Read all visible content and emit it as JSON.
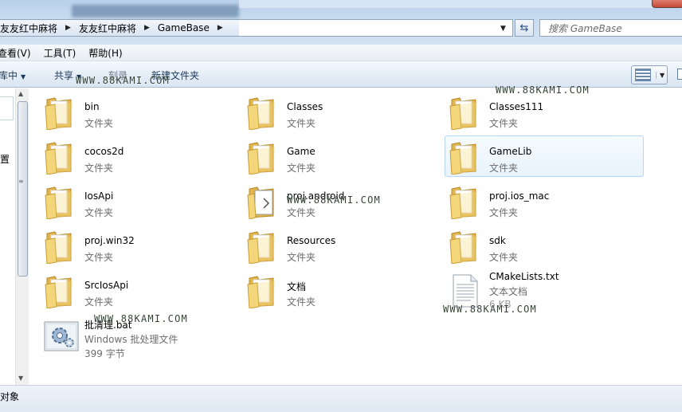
{
  "breadcrumbs": [
    "友友红中麻将",
    "友友红中麻将",
    "GameBase"
  ],
  "search": {
    "placeholder": "搜索 GameBase"
  },
  "menu": [
    "查看(V)",
    "工具(T)",
    "帮助(H)"
  ],
  "toolbar": {
    "include_library": "库中",
    "share": "共享",
    "burn": "刻录",
    "new_folder": "新建文件夹"
  },
  "nav": {
    "partial_label": "置"
  },
  "items": [
    {
      "name": "bin",
      "type": "文件夹",
      "icon": "folder-icon"
    },
    {
      "name": "Classes",
      "type": "文件夹",
      "icon": "folder-icon"
    },
    {
      "name": "Classes111",
      "type": "文件夹",
      "icon": "folder-icon"
    },
    {
      "name": "cocos2d",
      "type": "文件夹",
      "icon": "folder-icon"
    },
    {
      "name": "Game",
      "type": "文件夹",
      "icon": "folder-icon"
    },
    {
      "name": "GameLib",
      "type": "文件夹",
      "icon": "folder-icon",
      "selected": true
    },
    {
      "name": "IosApi",
      "type": "文件夹",
      "icon": "folder-icon"
    },
    {
      "name": "proj.android",
      "type": "文件夹",
      "icon": "folder-doc-icon"
    },
    {
      "name": "proj.ios_mac",
      "type": "文件夹",
      "icon": "folder-icon"
    },
    {
      "name": "proj.win32",
      "type": "文件夹",
      "icon": "folder-icon"
    },
    {
      "name": "Resources",
      "type": "文件夹",
      "icon": "folder-icon"
    },
    {
      "name": "sdk",
      "type": "文件夹",
      "icon": "folder-icon"
    },
    {
      "name": "SrcIosApi",
      "type": "文件夹",
      "icon": "folder-icon"
    },
    {
      "name": "文档",
      "type": "文件夹",
      "icon": "folder-icon"
    },
    {
      "name": "CMakeLists.txt",
      "type": "文本文档",
      "size": "6 KB",
      "icon": "text-file-icon"
    },
    {
      "name": "批清理.bat",
      "type": "Windows 批处理文件",
      "size": "399 字节",
      "icon": "batch-file-icon"
    }
  ],
  "status": {
    "text": "对象"
  },
  "watermark": "WWW.88KAMI.COM",
  "colors": {
    "folder": "#f4d67a",
    "selection_border": "#b8d6fb",
    "accent": "#1e395b"
  }
}
